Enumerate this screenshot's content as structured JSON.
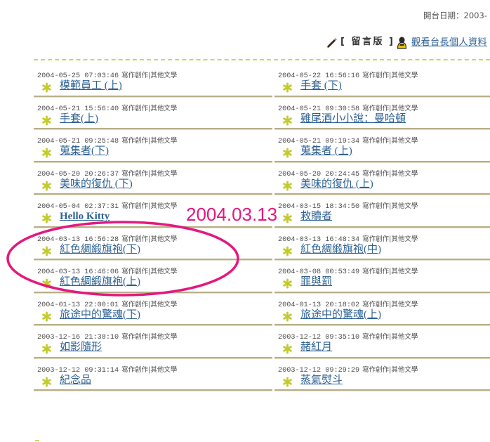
{
  "header": {
    "open_date": "開台日期：2003-",
    "guestbook_label": "[ 留言版 ]",
    "profile_link_label": "觀看台長個人資料"
  },
  "rows": [
    {
      "left": {
        "datetime": "2004-05-25 07:03:46",
        "category": "寫作創作|其他文學",
        "title": "模範員工 (上)"
      },
      "right": {
        "datetime": "2004-05-22 16:56:16",
        "category": "寫作創作|其他文學",
        "title": "手套 (下)"
      }
    },
    {
      "left": {
        "datetime": "2004-05-21 15:56:40",
        "category": "寫作創作|其他文學",
        "title": "手套(上)"
      },
      "right": {
        "datetime": "2004-05-21 09:30:58",
        "category": "寫作創作|其他文學",
        "title": "雞尾酒小小說：曼哈頓"
      }
    },
    {
      "left": {
        "datetime": "2004-05-21 09:25:48",
        "category": "寫作創作|其他文學",
        "title": "蒐集者(下)"
      },
      "right": {
        "datetime": "2004-05-21 09:19:34",
        "category": "寫作創作|其他文學",
        "title": "蒐集者 (上)"
      }
    },
    {
      "left": {
        "datetime": "2004-05-20 20:26:37",
        "category": "寫作創作|其他文學",
        "title": "美味的復仇 (下)"
      },
      "right": {
        "datetime": "2004-05-20 20:24:45",
        "category": "寫作創作|其他文學",
        "title": "美味的復仇 (上)"
      }
    },
    {
      "left": {
        "datetime": "2004-05-04 02:37:31",
        "category": "寫作創作|其他文學",
        "title": "Hello Kitty"
      },
      "right": {
        "datetime": "2004-03-15 18:34:50",
        "category": "寫作創作|其他文學",
        "title": "救贖者"
      }
    },
    {
      "left": {
        "datetime": "2004-03-13 16:56:28",
        "category": "寫作創作|其他文學",
        "title": "紅色綢緞旗袍(下)"
      },
      "right": {
        "datetime": "2004-03-13 16:48:34",
        "category": "寫作創作|其他文學",
        "title": "紅色綢緞旗袍(中)"
      }
    },
    {
      "left": {
        "datetime": "2004-03-13 16:46:06",
        "category": "寫作創作|其他文學",
        "title": "紅色綢緞旗袍(上)"
      },
      "right": {
        "datetime": "2004-03-08 00:53:49",
        "category": "寫作創作|其他文學",
        "title": "罪與罰"
      }
    },
    {
      "left": {
        "datetime": "2004-01-13 22:00:01",
        "category": "寫作創作|其他文學",
        "title": "旅途中的驚魂(下)"
      },
      "right": {
        "datetime": "2004-01-13 20:18:02",
        "category": "寫作創作|其他文學",
        "title": "旅途中的驚魂(上)"
      }
    },
    {
      "left": {
        "datetime": "2003-12-16 21:38:10",
        "category": "寫作創作|其他文學",
        "title": "如影隨形"
      },
      "right": {
        "datetime": "2003-12-12 09:35:10",
        "category": "寫作創作|其他文學",
        "title": "赭紅月"
      }
    },
    {
      "left": {
        "datetime": "2003-12-12 09:31:14",
        "category": "寫作創作|其他文學",
        "title": "紀念品"
      },
      "right": {
        "datetime": "2003-12-12 09:29:29",
        "category": "寫作創作|其他文學",
        "title": "蒸氣熨斗"
      }
    }
  ],
  "annotation": {
    "text": "2004.03.13"
  },
  "icons": {
    "guestbook": "pencil-icon",
    "profile": "user-profile-icon",
    "bullet": "star-bullet-icon"
  },
  "colors": {
    "link": "#2e6293",
    "meta_text": "#4d4d4d",
    "row_rule": "#b8ae88",
    "dashed_rule": "#cdd468",
    "bullet_star": "#c2cb2c",
    "annotation": "#e5177f"
  }
}
